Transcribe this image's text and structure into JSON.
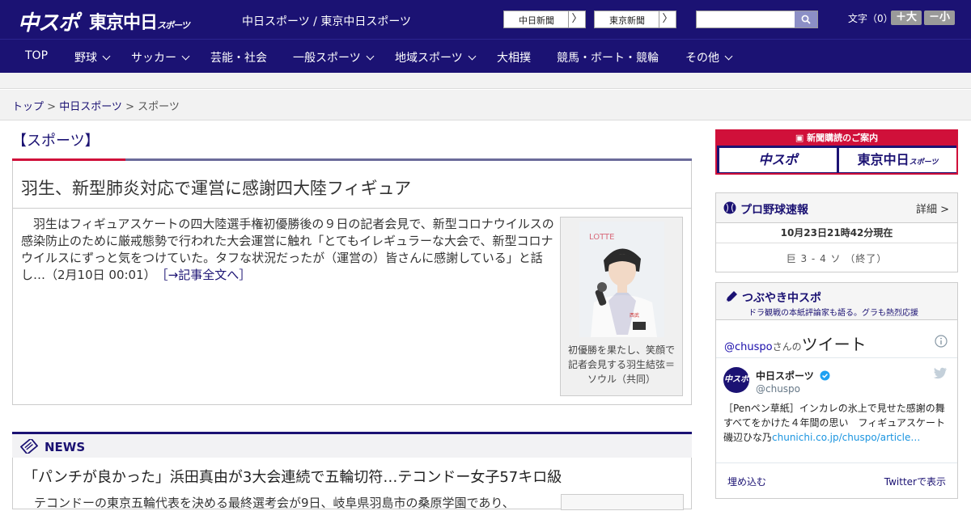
{
  "header": {
    "logo_main": "中スポ",
    "logo_tokyo": "東京中日",
    "logo_tokyo_small": "スポーツ",
    "site_title": "中日スポーツ / 東京中日スポーツ",
    "btn_chunichi": "中日新聞",
    "btn_tokyo": "東京新聞",
    "arrow": "〉",
    "search_placeholder": "",
    "fontsize_label": "文字（0）",
    "font_larger": "＋大",
    "font_smaller": "－小"
  },
  "nav": {
    "items": [
      {
        "label": "TOP"
      },
      {
        "label": "野球"
      },
      {
        "label": "サッカー"
      },
      {
        "label": "芸能・社会"
      },
      {
        "label": "一般スポーツ"
      },
      {
        "label": "地域スポーツ"
      },
      {
        "label": "大相撲"
      },
      {
        "label": "競馬・ボート・競輪"
      },
      {
        "label": "その他"
      }
    ]
  },
  "breadcrumb": {
    "top": "トップ",
    "sep": " > ",
    "chunichi": "中日スポーツ",
    "current": "スポーツ"
  },
  "main": {
    "section_title": "【スポーツ】",
    "article": {
      "title": "羽生、新型肺炎対応で運営に感謝四大陸フィギュア",
      "body": "　羽生はフィギュアスケートの四大陸選手権初優勝後の９日の記者会見で、新型コロナウイルスの感染防止のために厳戒態勢で行われた大会運営に触れ「とてもイレギュラーな大会で、新型コロナウイルスにずっと気をつけていた。タフな状況だったが（運営の）皆さんに感謝している」と話し…（2月10日 00:01）　",
      "more": "［→記事全文へ］",
      "photo_caption": "初優勝を果たし、笑顔で記者会見する羽生結弦＝ソウル（共同）"
    },
    "news": {
      "label": "NEWS",
      "title": "「パンチが良かった」浜田真由が3大会連続で五輪切符…テコンドー女子57キロ級",
      "text": "テコンドーの東京五輪代表を決める最終選考会が9日、岐阜県羽島市の桑原学園であり、"
    }
  },
  "sidebar": {
    "subscribe_head": "新聞購読のご案内",
    "subscribe_chuspo": "中スポ",
    "subscribe_tokyo": "東京中日",
    "subscribe_tokyo_small": "スポーツ",
    "npb_title": "プロ野球速報",
    "npb_detail": "詳細 >",
    "npb_time": "10月23日21時42分現在",
    "npb_score": "巨 3 - 4 ソ （終了）",
    "tw_title": "つぶやき中スポ",
    "tw_sub": "ドラ観戦の本紙評論家も語る。グラも熱烈応援",
    "tw_handle": "@chuspo",
    "tw_san": "さんの",
    "tw_tweet": "ツイート",
    "tw_name": "中日スポーツ",
    "tw_id": "@chuspo",
    "tw_avatar": "中スポ",
    "tw_text": "［Penペン草紙］インカレの氷上で見せた感謝の舞　すべてをかけた４年間の思い　フィギュアスケート　磯辺ひな乃",
    "tw_link": "chunichi.co.jp/chuspo/article…",
    "tw_embed": "埋め込む",
    "tw_view": "Twitterで表示"
  },
  "colors": {
    "brand_navy": "#1b1273",
    "accent_red": "#d0103a"
  }
}
